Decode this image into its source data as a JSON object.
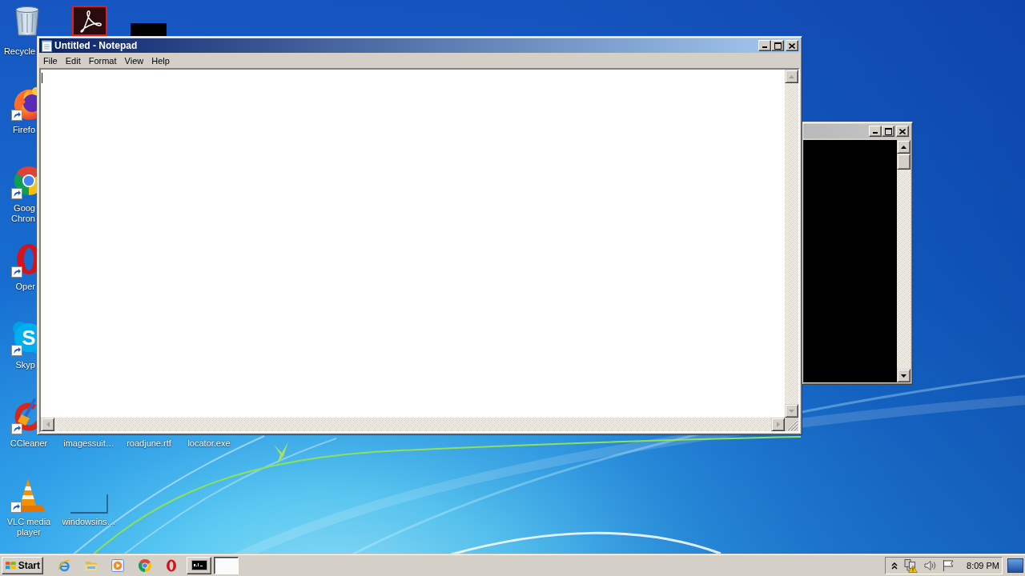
{
  "desktop": {
    "icons": [
      {
        "kind": "recycle-bin",
        "label": "Recycle",
        "shortcut": false
      },
      {
        "kind": "pdf-reader",
        "shortcut": false
      },
      {
        "kind": "blank-tile",
        "shortcut": false
      },
      {
        "kind": "firefox",
        "label": "Firefo",
        "shortcut": true
      },
      {
        "kind": "chrome",
        "label": "Goog Chron",
        "shortcut": true
      },
      {
        "kind": "opera",
        "label": "Oper",
        "shortcut": true
      },
      {
        "kind": "skype",
        "label": "Skyp",
        "glyph": "S",
        "shortcut": true
      },
      {
        "kind": "ccleaner",
        "label": "CCleaner",
        "shortcut": true
      },
      {
        "kind": "label-only",
        "label": "imagessuit…",
        "shortcut": false
      },
      {
        "kind": "label-only",
        "label": "roadjune.rtf",
        "shortcut": false
      },
      {
        "kind": "label-only",
        "label": "locator.exe",
        "shortcut": false
      },
      {
        "kind": "vlc",
        "label": "VLC media player",
        "shortcut": true
      },
      {
        "kind": "outline",
        "label": "windowsins…",
        "shortcut": false
      }
    ]
  },
  "notepad": {
    "title": "Untitled - Notepad",
    "active": true,
    "menu": [
      "File",
      "Edit",
      "Format",
      "View",
      "Help"
    ],
    "editor": {
      "focused": true,
      "scroll_enabled": false
    }
  },
  "console_window": {
    "active": false,
    "scroll_enabled": true
  },
  "taskbar": {
    "start_label": "Start",
    "tasks": [
      {
        "kind": "console",
        "selected": false
      },
      {
        "kind": "blank",
        "selected": true
      }
    ],
    "clock": "8:09 PM"
  }
}
